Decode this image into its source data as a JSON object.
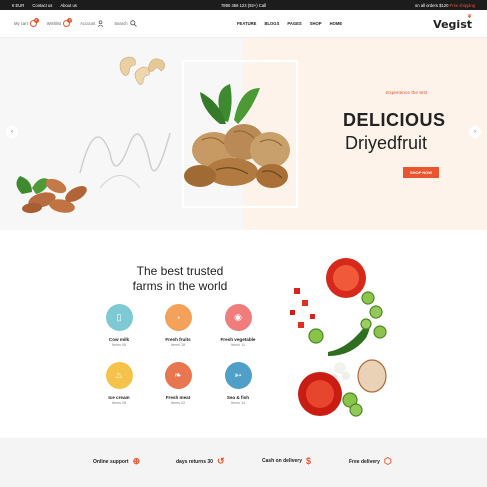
{
  "topbar": {
    "currency": "€ EUR",
    "contact": "Contact us",
    "about": "About us",
    "phone": "7890 456 123 (92+) Call",
    "shipping_text": "on all orders $120",
    "shipping_accent": "Free shipping"
  },
  "header": {
    "my_cart": "My cart",
    "wishlist": "Wishlist",
    "account": "Account",
    "search": "Search",
    "cart_count": "0",
    "wishlist_count": "0",
    "nav": [
      "FEATURE",
      "BLOGS",
      "PAGES",
      "SHOP",
      "HOME"
    ],
    "logo": "Vegist"
  },
  "hero": {
    "subtitle": "Experience the test",
    "title_line1": "DELICIOUS",
    "title_line2": "Driyedfruit",
    "button": "SHOP NOW",
    "prev_icon": "chevron-left-icon",
    "next_icon": "chevron-right-icon"
  },
  "farms": {
    "heading_line1": "The best trusted",
    "heading_line2": "farms in the world",
    "categories": [
      {
        "name": "Cow milk",
        "count": "Items 06",
        "color": "#7ec9d4",
        "icon": "milk-icon"
      },
      {
        "name": "Fresh fruits",
        "count": "Items 18",
        "color": "#f4a259",
        "icon": "fruit-icon"
      },
      {
        "name": "Fresh vegetable",
        "count": "Items 11",
        "color": "#f07c7c",
        "icon": "vegetable-icon"
      },
      {
        "name": "Ice cream",
        "count": "Items 08",
        "color": "#f6c34a",
        "icon": "ice-cream-icon"
      },
      {
        "name": "Fresh meat",
        "count": "Items 02",
        "color": "#e8764f",
        "icon": "meat-icon"
      },
      {
        "name": "Sea & fish",
        "count": "Items 14",
        "color": "#4f9fc8",
        "icon": "fish-icon"
      }
    ]
  },
  "features": [
    {
      "label": "Online support",
      "icon": "globe-icon"
    },
    {
      "label": "days returns 30",
      "icon": "return-icon"
    },
    {
      "label": "Cash on delivery",
      "icon": "dollar-icon"
    },
    {
      "label": "Free delivery",
      "icon": "box-icon"
    }
  ],
  "colors": {
    "accent": "#e8552f",
    "peach": "#fdf3ea"
  }
}
